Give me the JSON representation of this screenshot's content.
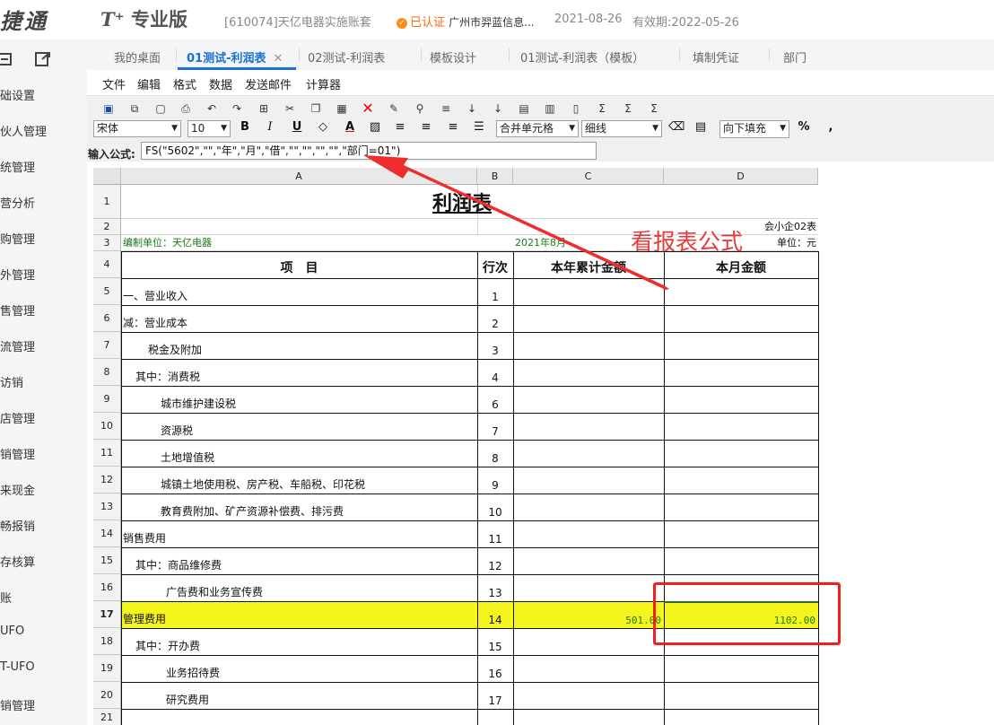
{
  "header": {
    "brand": "捷通",
    "edition_prefix": "T⁺",
    "edition": "专业版",
    "account": "[610074]天亿电器实施账套",
    "cert_label": "已认证",
    "company": "广州市羿蓝信息...",
    "date": "2021-08-26",
    "validity": "有效期:2022-05-26"
  },
  "sidebar": {
    "items": [
      "础设置",
      "伙人管理",
      "统管理",
      "营分析",
      "购管理",
      "外管理",
      "售管理",
      "流管理",
      "访销",
      "店管理",
      "销管理",
      "来现金",
      "畅报销",
      "存核算",
      "账",
      "UFO",
      "T-UFO",
      "销管理"
    ]
  },
  "tabs": {
    "items": [
      "我的桌面",
      "01测试-利润表",
      "02测试-利润表",
      "模板设计",
      "01测试-利润表（模板）",
      "填制凭证",
      "部门"
    ],
    "active": "01测试-利润表",
    "close_glyph": "✕"
  },
  "menu": {
    "items": [
      "文件",
      "编辑",
      "格式",
      "数据",
      "发送邮件",
      "计算器"
    ]
  },
  "toolbar": {
    "font": "宋体",
    "font_size": "10",
    "merge": "合并单元格",
    "border": "细线",
    "fill": "向下填充",
    "bold": "B",
    "italic": "I",
    "underline": "U",
    "color_a": "A",
    "percent": "%",
    "comma": ","
  },
  "formula": {
    "label": "输入公式:",
    "value": "FS(\"5602\",\"\",\"年\",\"月\",\"借\",\"\",\"\",\"\",\"\",\"部门=01\")"
  },
  "sheet": {
    "columns": [
      "A",
      "B",
      "C",
      "D"
    ],
    "rows": [
      "1",
      "2",
      "3",
      "4",
      "5",
      "6",
      "7",
      "8",
      "9",
      "10",
      "11",
      "12",
      "13",
      "14",
      "15",
      "16",
      "17",
      "18",
      "19",
      "20",
      "21"
    ],
    "title": "利润表",
    "form_no": "会小企02表",
    "unit_org": "编制单位：天亿电器",
    "period": "2021年8月",
    "unit": "单位：元",
    "head_item": "项　目",
    "head_line": "行次",
    "head_year": "本年累计金额",
    "head_month": "本月金额",
    "lines": [
      {
        "item": "一、营业收入",
        "no": "1"
      },
      {
        "item": "减：营业成本",
        "no": "2"
      },
      {
        "item": "税金及附加",
        "no": "3"
      },
      {
        "item": "其中：消费税",
        "no": "4"
      },
      {
        "item": "城市维护建设税",
        "no": "6"
      },
      {
        "item": "资源税",
        "no": "7"
      },
      {
        "item": "土地增值税",
        "no": "8"
      },
      {
        "item": "城镇土地使用税、房产税、车船税、印花税",
        "no": "9"
      },
      {
        "item": "教育费附加、矿产资源补偿费、排污费",
        "no": "10"
      },
      {
        "item": "销售费用",
        "no": "11"
      },
      {
        "item": "其中：商品维修费",
        "no": "12"
      },
      {
        "item": "广告费和业务宣传费",
        "no": "13"
      },
      {
        "item": "管理费用",
        "no": "14",
        "year": "501.00",
        "month": "1102.00"
      },
      {
        "item": "其中：开办费",
        "no": "15"
      },
      {
        "item": "业务招待费",
        "no": "16"
      },
      {
        "item": "研究费用",
        "no": "17"
      }
    ]
  },
  "annotation": {
    "text": "看报表公式"
  },
  "colors": {
    "accent": "#1a6fd6",
    "highlight": "#f5f51e",
    "annotation": "#e83a3a",
    "cert": "#ff6a00"
  }
}
